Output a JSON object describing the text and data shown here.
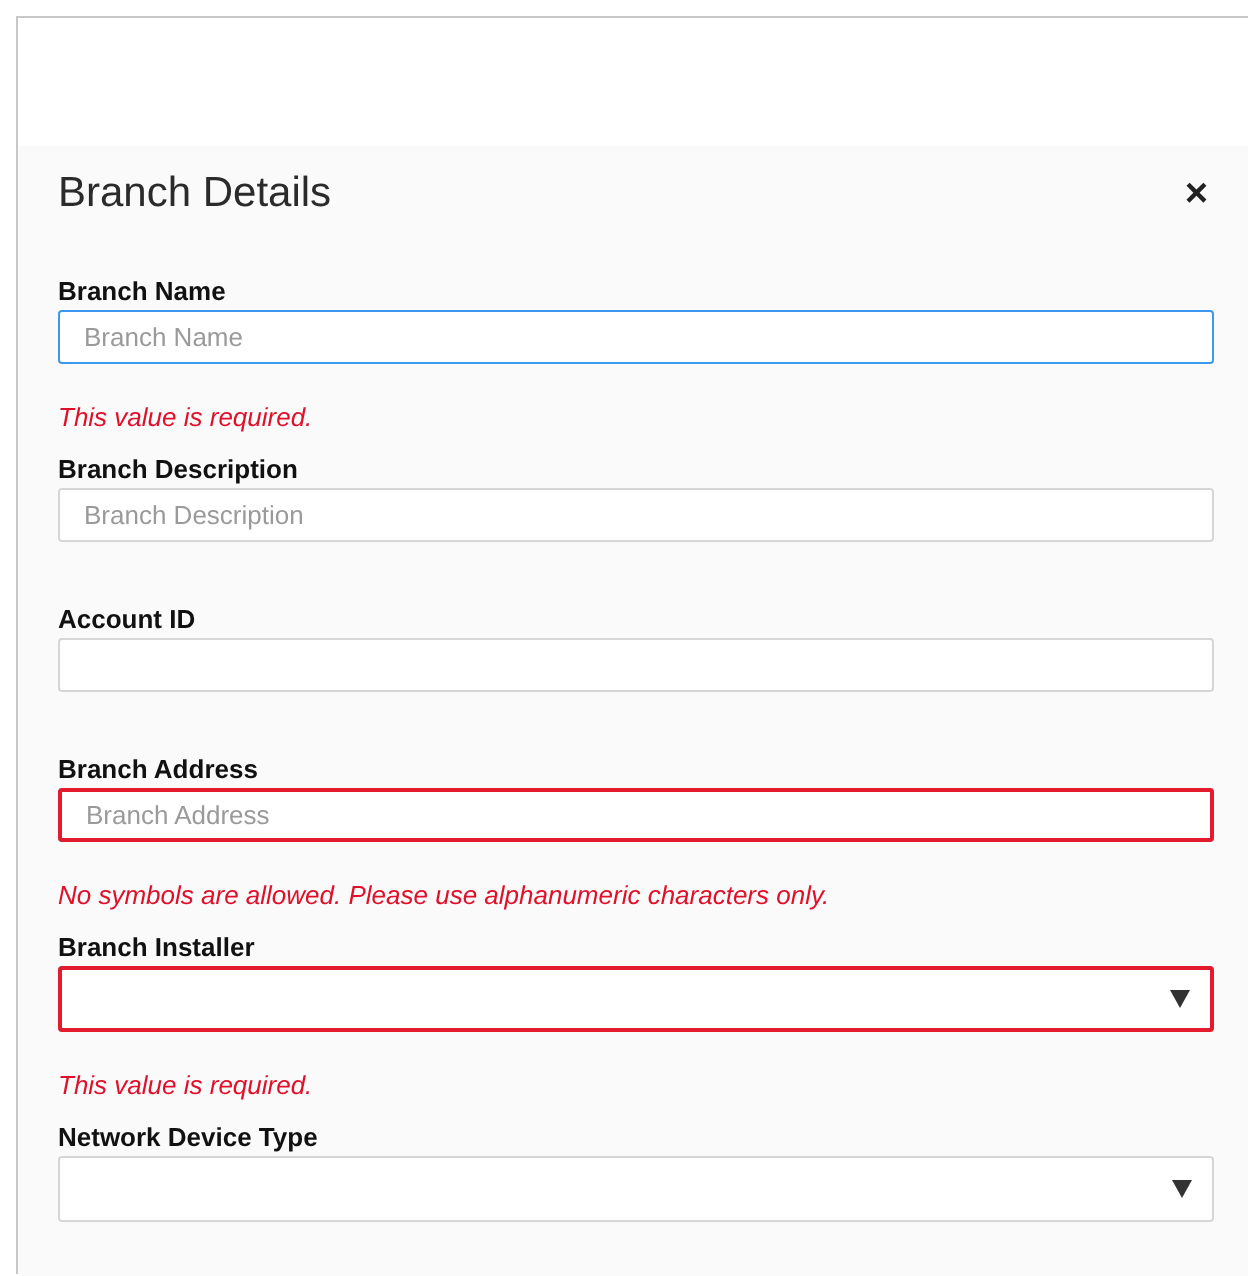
{
  "dialog": {
    "title": "Branch Details",
    "close": "×"
  },
  "fields": [
    {
      "label": "Branch Name",
      "kind": "text",
      "placeholder": "Branch Name",
      "focused": true,
      "invalid": false,
      "error": "This value is required."
    },
    {
      "label": "Branch Description",
      "kind": "text",
      "placeholder": "Branch Description",
      "focused": false,
      "invalid": false
    },
    {
      "label": "Account ID",
      "kind": "text",
      "focused": false,
      "invalid": false
    },
    {
      "label": "Branch Address",
      "kind": "text",
      "placeholder": "Branch Address",
      "focused": false,
      "invalid": true,
      "error": "No symbols are allowed. Please use alphanumeric characters only."
    },
    {
      "label": "Branch Installer",
      "kind": "select",
      "focused": false,
      "invalid": true,
      "error": "This value is required."
    },
    {
      "label": "Network Device Type",
      "kind": "select",
      "focused": false,
      "invalid": false
    }
  ]
}
